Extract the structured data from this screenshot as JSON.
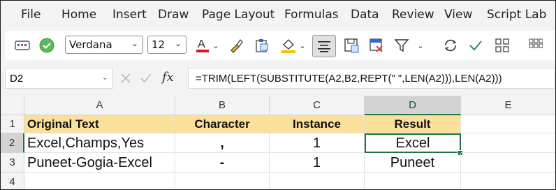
{
  "menu": {
    "items": [
      "File",
      "Home",
      "Insert",
      "Draw",
      "Page Layout",
      "Formulas",
      "Data",
      "Review",
      "View",
      "Script Lab"
    ]
  },
  "toolbar": {
    "font_name": "Verdana",
    "font_size": "12",
    "icons": [
      "keyboard-icon",
      "check-circle-icon",
      "font-color-icon",
      "format-painter-icon",
      "clipboard-icon",
      "fill-color-icon",
      "align-center-icon",
      "save-icon",
      "clear-filter-icon",
      "filter-icon",
      "refresh-icon",
      "check-icon",
      "grid-icon"
    ],
    "colors": {
      "font_color": "#e81123",
      "fill_color": "#f5c400",
      "check": "#2e8b57"
    }
  },
  "formula_bar": {
    "name_box": "D2",
    "fx": "fx",
    "formula": "=TRIM(LEFT(SUBSTITUTE(A2,B2,REPT(\" \",LEN(A2))),LEN(A2)))"
  },
  "sheet": {
    "columns": [
      "A",
      "B",
      "C",
      "D",
      "E"
    ],
    "rows": [
      "1",
      "2",
      "3",
      "4"
    ],
    "cells": [
      [
        "Original Text",
        "Character",
        "Instance",
        "Result"
      ],
      [
        "Excel,Champs,Yes",
        ",",
        "1",
        "Excel"
      ],
      [
        "Puneet-Gogia-Excel",
        "-",
        "1",
        "Puneet"
      ]
    ],
    "selected_cell": "D2",
    "header_fill": "#fbe09a",
    "accent": "#217346"
  }
}
